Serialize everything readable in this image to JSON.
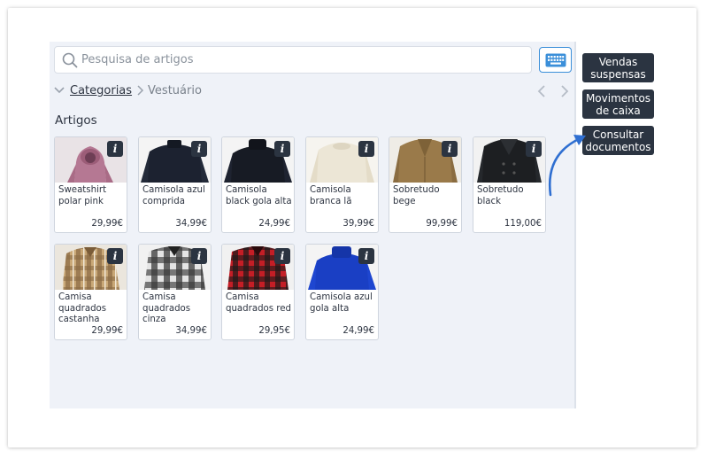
{
  "search": {
    "placeholder": "Pesquisa de artigos",
    "value": ""
  },
  "icons": {
    "search": "search-icon",
    "keyboard": "keyboard-icon",
    "chevron_down": "chevron-down-icon",
    "chevron_right": "chevron-right-icon",
    "prev": "chevron-left-icon",
    "next": "chevron-right-icon",
    "info": "info-icon",
    "arrow": "curved-arrow-icon"
  },
  "breadcrumb": {
    "root": "Categorias",
    "current": "Vestuário"
  },
  "section_title": "Artigos",
  "info_label": "i",
  "products": [
    {
      "name": "Sweatshirt polar pink",
      "price": "29,99€",
      "image": "pink-hoodie"
    },
    {
      "name": "Camisola azul comprida",
      "price": "34,99€",
      "image": "navy-sweater"
    },
    {
      "name": "Camisola black gola alta",
      "price": "24,99€",
      "image": "black-turtleneck"
    },
    {
      "name": "Camisola branca lã",
      "price": "39,99€",
      "image": "white-wool-sweater"
    },
    {
      "name": "Sobretudo bege",
      "price": "99,99€",
      "image": "beige-coat"
    },
    {
      "name": "Sobretudo black",
      "price": "119,00€",
      "image": "black-coat"
    },
    {
      "name": "Camisa quadrados castanha",
      "price": "29,99€",
      "image": "brown-plaid-shirt"
    },
    {
      "name": "Camisa quadrados cinza",
      "price": "34,99€",
      "image": "grey-plaid-shirt"
    },
    {
      "name": "Camisa quadrados red",
      "price": "29,95€",
      "image": "red-plaid-shirt"
    },
    {
      "name": "Camisola azul gola alta",
      "price": "24,99€",
      "image": "blue-turtleneck"
    }
  ],
  "side_buttons": [
    {
      "label": "Vendas\nsuspensas"
    },
    {
      "label": "Movimentos\nde caixa"
    },
    {
      "label": "Consultar\ndocumentos"
    }
  ],
  "colors": {
    "accent": "#3b8fd9",
    "dark_button": "#2b3441",
    "panel_bg": "#eff2f8",
    "arrow": "#2f6fd1"
  }
}
